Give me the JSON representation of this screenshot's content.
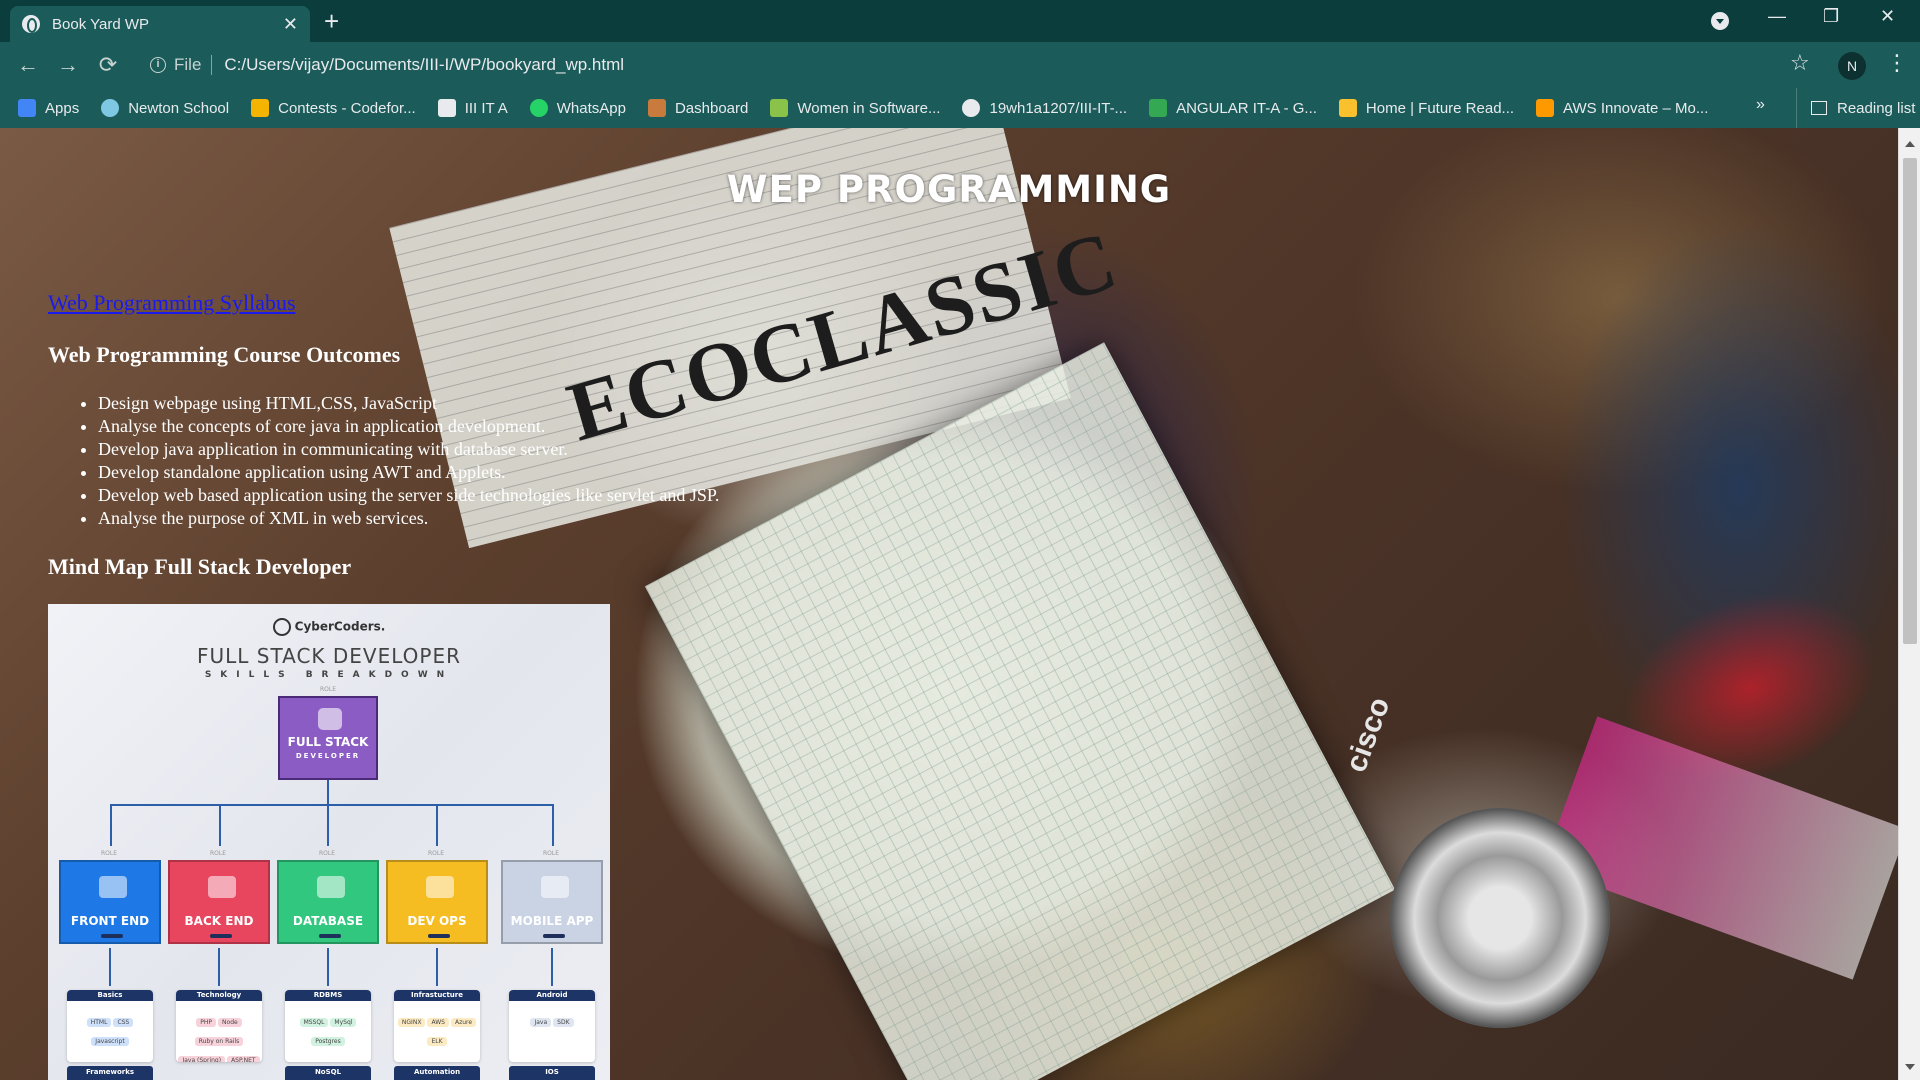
{
  "browser": {
    "tab_title": "Book Yard WP",
    "tab_close": "✕",
    "new_tab": "+",
    "address_scheme": "File",
    "address_url": "C:/Users/vijay/Documents/III-I/WP/bookyard_wp.html",
    "avatar_initial": "N",
    "window_controls": {
      "minimize": "—",
      "restore": "❐",
      "close": "✕"
    },
    "nav": {
      "back": "←",
      "forward": "→",
      "reload": "⟳"
    },
    "star": "☆",
    "menu": "⋮"
  },
  "bookmarks": [
    {
      "label": "Apps",
      "icon": "apps-grid-icon",
      "color": "#4285f4"
    },
    {
      "label": "Newton School",
      "icon": "newton-school-icon",
      "color": "#7ec8e3"
    },
    {
      "label": "Contests - Codefor...",
      "icon": "codeforces-icon",
      "color": "#f4b400"
    },
    {
      "label": "III IT A",
      "icon": "classroom-icon",
      "color": "#e8eaed"
    },
    {
      "label": "WhatsApp",
      "icon": "whatsapp-icon",
      "color": "#25d366"
    },
    {
      "label": "Dashboard",
      "icon": "dashboard-icon",
      "color": "#c97b3e"
    },
    {
      "label": "Women in Software...",
      "icon": "runner-icon",
      "color": "#8bc34a"
    },
    {
      "label": "19wh1a1207/III-IT-...",
      "icon": "github-icon",
      "color": "#e8eaed"
    },
    {
      "label": "ANGULAR IT-A - G...",
      "icon": "google-drive-icon",
      "color": "#34a853"
    },
    {
      "label": "Home | Future Read...",
      "icon": "future-ready-icon",
      "color": "#fbc02d"
    },
    {
      "label": "AWS Innovate – Mo...",
      "icon": "aws-icon",
      "color": "#ff9900"
    }
  ],
  "bookmarks_overflow": "»",
  "reading_list": "Reading list",
  "page": {
    "title": "WEP PROGRAMMING",
    "syllabus_link": "Web Programming Syllabus",
    "outcomes_heading": "Web Programming Course Outcomes",
    "outcomes": [
      "Design webpage using HTML,CSS, JavaScript",
      "Analyse the concepts of core java in application development.",
      "Develop java application in communicating with database server.",
      "Develop standalone application using AWT and Applets.",
      "Develop web based application using the server side technologies like servlet and JSP.",
      "Analyse the purpose of XML in web services."
    ],
    "mindmap_heading": "Mind Map Full Stack Developer",
    "background_text": "ECOCLASSIC",
    "background_brand": "cisco"
  },
  "mindmap": {
    "logo": "CyberCoders.",
    "title": "FULL STACK DEVELOPER",
    "subtitle": "SKILLS BREAKDOWN",
    "role_tag": "ROLE",
    "center": {
      "label": "FULL STACK",
      "sub": "DEVELOPER",
      "color": "#8a5cc4"
    },
    "roles": [
      {
        "label": "FRONT END",
        "color": "#1e78e6",
        "category": "Basics",
        "chips": [
          "HTML",
          "CSS",
          "Javascript"
        ],
        "chip_color": "#cfe0fb",
        "footer": "Frameworks"
      },
      {
        "label": "BACK END",
        "color": "#e8455f",
        "category": "Technology",
        "chips": [
          "PHP",
          "Node",
          "Ruby on Rails",
          "Java (Spring)",
          "ASP.NET"
        ],
        "chip_color": "#f8d2da",
        "footer": ""
      },
      {
        "label": "DATABASE",
        "color": "#31c77f",
        "category": "RDBMS",
        "chips": [
          "MSSQL",
          "MySql",
          "Postgres"
        ],
        "chip_color": "#d1f2e0",
        "footer": "NoSQL"
      },
      {
        "label": "DEV OPS",
        "color": "#f6bd22",
        "category": "Infrastucture",
        "chips": [
          "NGINX",
          "AWS",
          "Azure",
          "ELK"
        ],
        "chip_color": "#fbeac2",
        "footer": "Automation"
      },
      {
        "label": "MOBILE APP",
        "color": "#c9d3e4",
        "category": "Android",
        "chips": [
          "Java",
          "SDK"
        ],
        "chip_color": "#dfe6f1",
        "footer": "IOS"
      }
    ]
  }
}
